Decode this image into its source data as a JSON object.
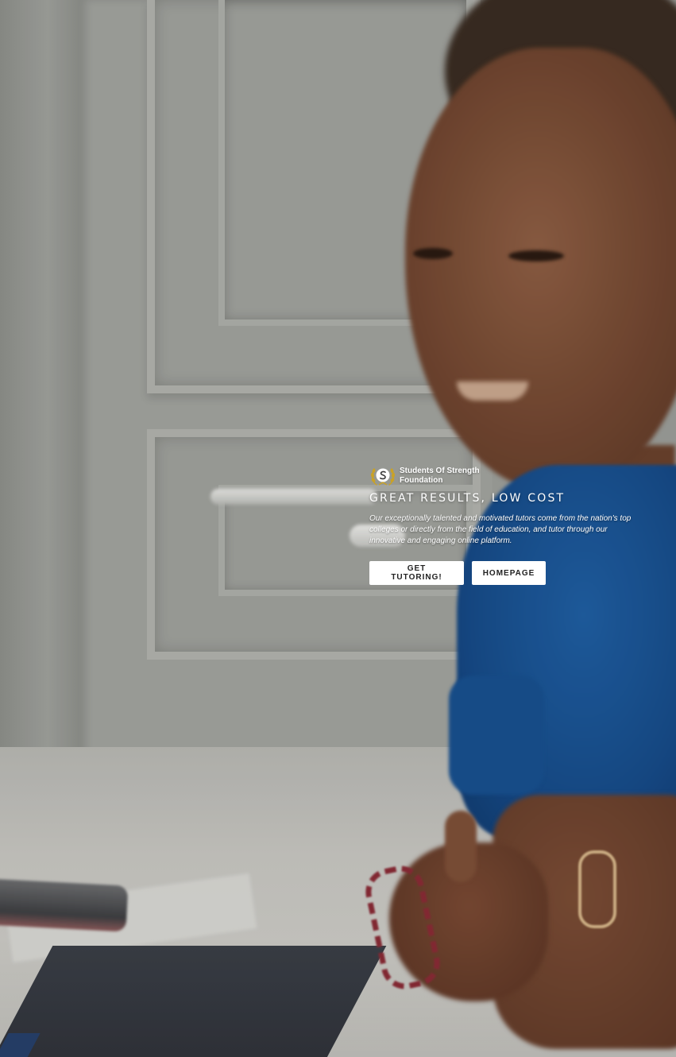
{
  "brand": {
    "logo_icon": "laurel-wreath-logo-icon",
    "name": "Students Of Strength Foundation",
    "accent_color": "#c9a227"
  },
  "hero": {
    "headline": "GREAT RESULTS, LOW COST",
    "tagline": "Our exceptionally talented and motivated tutors come from the nation's top colleges or directly from the field of education, and tutor through our innovative and engaging online platform.",
    "background": "video-still-child-at-laptop"
  },
  "actions": {
    "primary_label": "GET TUTORING!",
    "secondary_label": "HOMEPAGE",
    "button_bg": "#ffffff",
    "button_text_color": "#222222"
  }
}
